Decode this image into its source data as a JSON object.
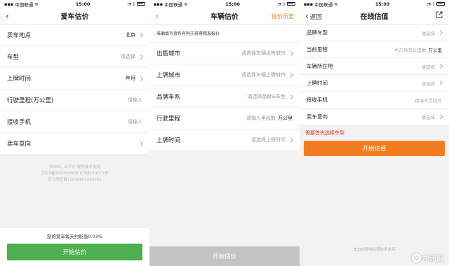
{
  "status": {
    "carrier": "中国联通",
    "s1_time": "15:00",
    "s2_time": "15:00",
    "s3_time": "15:03"
  },
  "screen1": {
    "title": "爱车估价",
    "rows": [
      {
        "label": "卖车地点",
        "value": "北京"
      },
      {
        "label": "车型",
        "value": "请选择"
      },
      {
        "label": "上牌时间",
        "value": "年月"
      },
      {
        "label": "行驶里程(万公里)",
        "value": "请输入"
      },
      {
        "label": "接收手机",
        "value": "请输入"
      },
      {
        "label": "卖车意向",
        "value": ""
      }
    ],
    "footer_lines": [
      "车300，公平价 提供技术支持",
      "京ICP备15000080号 ICP证150071号",
      "京公网安备11010802020161"
    ],
    "tip": "您的爱车每天约贬值0.03%",
    "button": "开始估价"
  },
  "screen2": {
    "title": "车辆估价",
    "right_link": "估价历史",
    "hint": "准确填写资料有利于获得精准报价",
    "rows": [
      {
        "label": "出售城市",
        "value": "请选择车辆出售城市",
        "unit": ""
      },
      {
        "label": "上牌城市",
        "value": "请选择车辆上牌城市",
        "unit": ""
      },
      {
        "label": "品牌车系",
        "value": "请选择品牌&车型",
        "unit": ""
      },
      {
        "label": "行驶里程",
        "value": "请输入里程数",
        "unit": "万公里"
      },
      {
        "label": "上牌时间",
        "value": "请选择上牌时间",
        "unit": ""
      }
    ],
    "button": "开始估价"
  },
  "screen3": {
    "back_label": "返回",
    "title": "在线估值",
    "rows": [
      {
        "label": "品牌车型",
        "value": "请选择",
        "unit": ""
      },
      {
        "label": "当前里程",
        "value": "点击填写公里数",
        "unit": "万公里"
      },
      {
        "label": "车辆所在地",
        "value": "请选择",
        "unit": ""
      },
      {
        "label": "上牌时间",
        "value": "请选择",
        "unit": ""
      },
      {
        "label": "接收手机",
        "value": "请填写手机号",
        "unit": ""
      },
      {
        "label": "卖车意向",
        "value": "请选择",
        "unit": ""
      }
    ],
    "warning": "需要首先选择车型",
    "button": "开始估值",
    "footer": "车300提供估值技术支持",
    "watermark": "车讯网"
  },
  "colors": {
    "green": "#4caf50",
    "orange": "#f47c20",
    "gray_button": "#c4c4c4",
    "warning_red": "#e0322b"
  }
}
